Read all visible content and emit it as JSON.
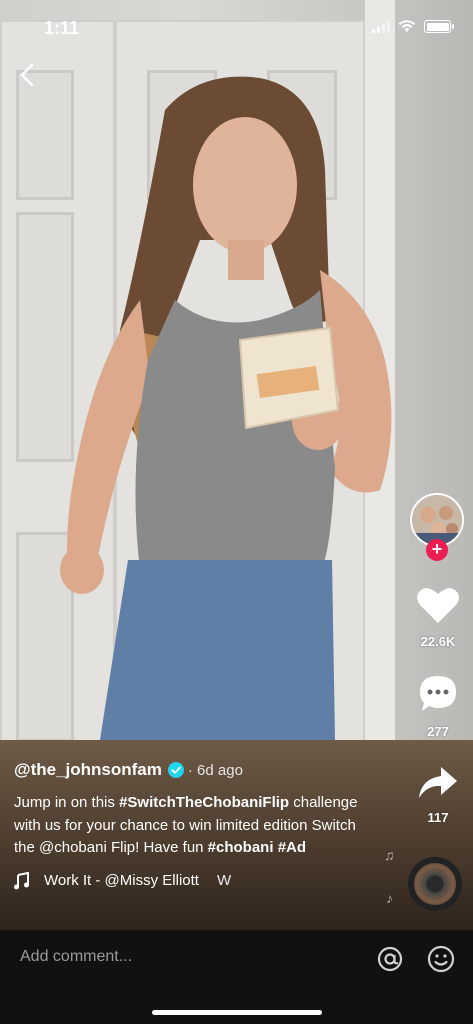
{
  "status_bar": {
    "time": "1:11"
  },
  "video": {
    "author": "@the_johnsonfam",
    "posted": "· 6d ago",
    "description_parts": [
      {
        "text": "Jump in on this ",
        "bold": false
      },
      {
        "text": "#SwitchTheChobaniFlip",
        "bold": true
      },
      {
        "text": " challenge with us for your chance to win limited edition Switch the @chobani Flip! Have fun ",
        "bold": false
      },
      {
        "text": "#chobani",
        "bold": true
      },
      {
        "text": " ",
        "bold": false
      },
      {
        "text": "#Ad",
        "bold": true
      }
    ],
    "music": "Work It - @Missy Elliott",
    "music_scroll_tail": "W"
  },
  "actions": {
    "likes": "22.6K",
    "comments": "277",
    "shares": "117"
  },
  "comment_bar": {
    "placeholder": "Add comment..."
  },
  "icons": {
    "back": "chevron-left-icon",
    "like": "heart-icon",
    "comment": "speech-bubble-icon",
    "share": "share-arrow-icon",
    "music": "music-note-icon",
    "mention": "at-sign-icon",
    "emoji": "smiley-icon"
  },
  "colors": {
    "follow_plus": "#ee1d52",
    "verified": "#20d5ec"
  }
}
